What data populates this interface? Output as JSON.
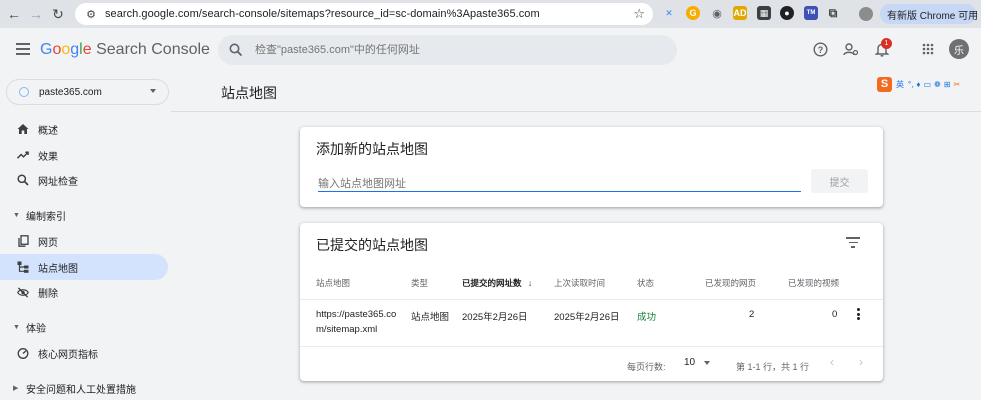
{
  "browser": {
    "url": "search.google.com/search-console/sitemaps?resource_id=sc-domain%3Apaste365.com",
    "update_label": "有新版 Chrome 可用"
  },
  "header": {
    "logo_google": [
      "G",
      "o",
      "o",
      "g",
      "l",
      "e"
    ],
    "logo_product": "Search Console",
    "search_placeholder": "检查\"paste365.com\"中的任何网址",
    "notification_count": "1",
    "avatar_letter": "乐"
  },
  "property": {
    "name": "paste365.com"
  },
  "sidebar": {
    "items": [
      {
        "label": "概述",
        "icon": "home-icon"
      },
      {
        "label": "效果",
        "icon": "trending-up-icon"
      },
      {
        "label": "网址检查",
        "icon": "search-icon"
      }
    ],
    "section_index": "编制索引",
    "index_items": [
      {
        "label": "网页",
        "icon": "pages-icon"
      },
      {
        "label": "站点地图",
        "icon": "sitemap-icon"
      },
      {
        "label": "删除",
        "icon": "removals-icon"
      }
    ],
    "section_experience": "体验",
    "experience_items": [
      {
        "label": "核心网页指标",
        "icon": "speed-icon"
      }
    ],
    "section_security": "安全问题和人工处置措施"
  },
  "main": {
    "page_title": "站点地图",
    "add_card": {
      "title": "添加新的站点地图",
      "input_placeholder": "输入站点地图网址",
      "submit_label": "提交"
    },
    "submitted_card": {
      "title": "已提交的站点地图",
      "columns": [
        "站点地图",
        "类型",
        "已提交的网址数",
        "上次读取时间",
        "状态",
        "已发现的网页",
        "已发现的视频"
      ],
      "rows": [
        {
          "sitemap_line1": "https://paste365.co",
          "sitemap_line2": "m/sitemap.xml",
          "type": "站点地图",
          "submitted": "2025年2月26日",
          "last_read": "2025年2月26日",
          "status": "成功",
          "pages": "2",
          "videos": "0"
        }
      ],
      "footer": {
        "rows_per_page_label": "每页行数:",
        "rows_per_page_value": "10",
        "range_label": "第 1-1 行，共 1 行"
      }
    }
  },
  "ime": {
    "logo": "S",
    "mode": "英"
  },
  "colors": {
    "accent": "#1a73e8",
    "active_nav": "#d3e3fd",
    "success": "#188038",
    "badge": "#d93025"
  }
}
